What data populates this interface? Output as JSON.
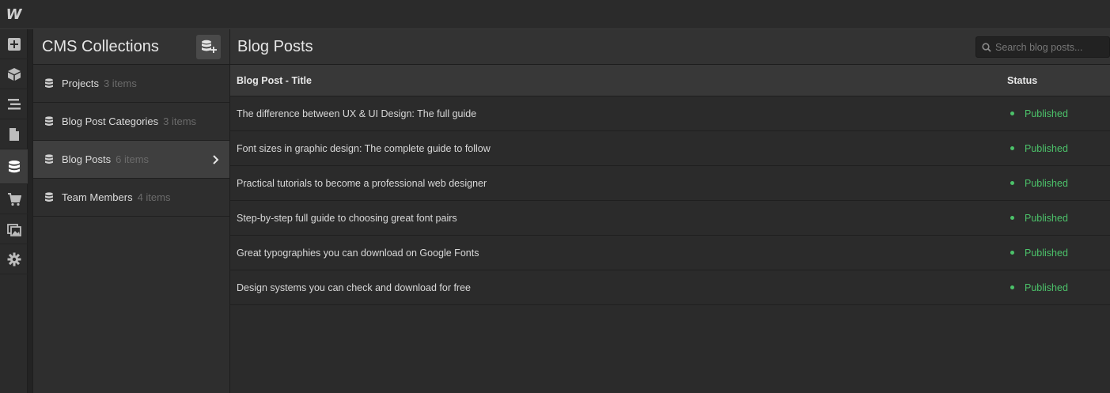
{
  "app": {
    "logo": "W"
  },
  "rail": [
    {
      "name": "add-icon"
    },
    {
      "name": "cube-icon"
    },
    {
      "name": "navigator-icon"
    },
    {
      "name": "pages-icon"
    },
    {
      "name": "database-icon"
    },
    {
      "name": "cart-icon"
    },
    {
      "name": "assets-icon"
    },
    {
      "name": "gear-icon"
    }
  ],
  "collections": {
    "title": "CMS Collections",
    "items": [
      {
        "label": "Projects",
        "count": "3 items"
      },
      {
        "label": "Blog Post Categories",
        "count": "3 items"
      },
      {
        "label": "Blog Posts",
        "count": "6 items"
      },
      {
        "label": "Team Members",
        "count": "4 items"
      }
    ]
  },
  "main": {
    "title": "Blog Posts",
    "search_placeholder": "Search blog posts...",
    "columns": {
      "title": "Blog Post - Title",
      "status": "Status"
    },
    "rows": [
      {
        "title": "The difference between UX & UI Design: The full guide",
        "status": "Published"
      },
      {
        "title": "Font sizes in graphic design: The complete guide to follow",
        "status": "Published"
      },
      {
        "title": "Practical tutorials to become a professional web designer",
        "status": "Published"
      },
      {
        "title": "Step-by-step full guide to choosing great font pairs",
        "status": "Published"
      },
      {
        "title": "Great typographies you can download on Google Fonts",
        "status": "Published"
      },
      {
        "title": "Design systems you can check and download for free",
        "status": "Published"
      }
    ]
  },
  "colors": {
    "published": "#4cc26a",
    "active_row": "#3f3f3f"
  }
}
